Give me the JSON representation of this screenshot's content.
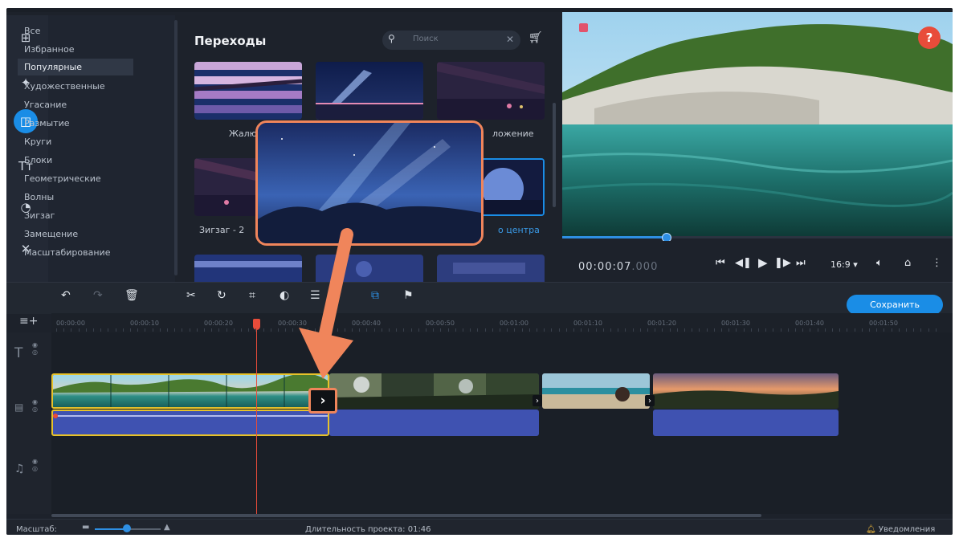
{
  "categories": {
    "items": [
      {
        "label": "Все"
      },
      {
        "label": "Избранное"
      },
      {
        "label": "Популярные",
        "selected": true
      },
      {
        "label": "Художественные"
      },
      {
        "label": "Угасание"
      },
      {
        "label": "Размытие"
      },
      {
        "label": "Круги"
      },
      {
        "label": "Блоки"
      },
      {
        "label": "Геометрические"
      },
      {
        "label": "Волны"
      },
      {
        "label": "Зигзаг"
      },
      {
        "label": "Замещение"
      },
      {
        "label": "Масштабирование"
      }
    ]
  },
  "sidebar_icons": [
    "import-icon",
    "filters-icon",
    "transitions-icon",
    "titles-icon",
    "stickers-icon",
    "tools-icon"
  ],
  "transitions": {
    "title": "Переходы",
    "search_placeholder": "Поиск",
    "thumbs": [
      {
        "label": "Жалюз"
      },
      {
        "label": ""
      },
      {
        "label": "ложение"
      },
      {
        "label": "Зигзаг - 2"
      },
      {
        "label": ""
      },
      {
        "label": "о центра"
      }
    ]
  },
  "player": {
    "timecode_main": "00:00:07",
    "timecode_frac": ".000",
    "aspect": "16:9",
    "progress": 0.27
  },
  "toolbar": {
    "save_label": "Сохранить"
  },
  "ruler": [
    "00:00:00",
    "00:00:10",
    "00:00:20",
    "00:00:30",
    "00:00:40",
    "00:00:50",
    "00:01:00",
    "00:01:10",
    "00:01:20",
    "00:01:30",
    "00:01:40",
    "00:01:50"
  ],
  "status": {
    "zoom_label": "Масштаб:",
    "duration_text": "Длительность проекта: 01:46",
    "notifications_label": "Уведомления"
  },
  "colors": {
    "accent": "#1a8de6",
    "highlight": "#f0855b",
    "audio_clip": "#3f52b1",
    "playhead": "#e84c3a",
    "selection": "#e7c22a"
  }
}
